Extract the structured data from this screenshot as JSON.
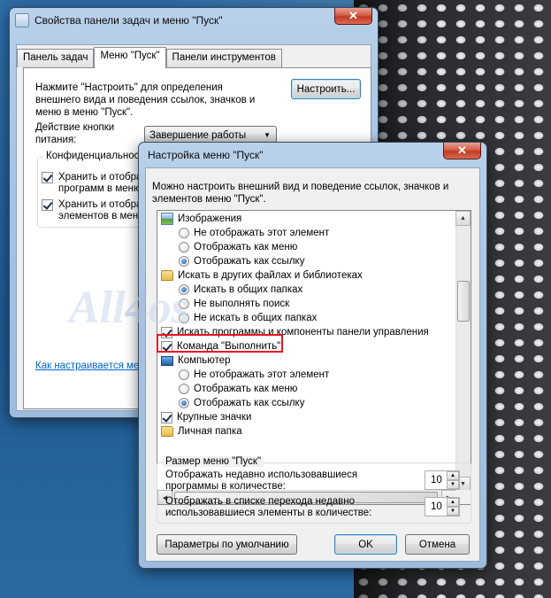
{
  "back_window": {
    "title": "Свойства панели задач и меню \"Пуск\"",
    "close_glyph": "✕",
    "tabs": [
      {
        "label": "Панель задач",
        "active": false
      },
      {
        "label": "Меню \"Пуск\"",
        "active": true
      },
      {
        "label": "Панели инструментов",
        "active": false
      }
    ],
    "customize_text": "Нажмите \"Настроить\" для определения внешнего вида и поведения ссылок, значков и меню в меню \"Пуск\".",
    "customize_button": "Настроить...",
    "power_action_label": "Действие кнопки питания:",
    "power_action_value": "Завершение работы",
    "privacy_group_title": "Конфиденциальность",
    "privacy_items": [
      {
        "label": "Хранить и отобра",
        "label2": "программ в меню",
        "checked": true
      },
      {
        "label": "Хранить и отобра",
        "label2": "элементов в меню",
        "checked": true
      }
    ],
    "help_link": "Как настраивается меню"
  },
  "watermark": {
    "part1": "All",
    "part2": "4",
    "part3": "os"
  },
  "dialog": {
    "title": "Настройка меню \"Пуск\"",
    "close_glyph": "✕",
    "description": "Можно настроить внешний вид и поведение ссылок, значков и элементов меню \"Пуск\".",
    "items": [
      {
        "kind": "icon",
        "icon": "image-icon",
        "label": "Изображения"
      },
      {
        "kind": "radio",
        "selected": false,
        "label": "Не отображать этот элемент"
      },
      {
        "kind": "radio",
        "selected": false,
        "label": "Отображать как меню"
      },
      {
        "kind": "radio",
        "selected": true,
        "label": "Отображать как ссылку"
      },
      {
        "kind": "icon",
        "icon": "folder-icon",
        "label": "Искать в других файлах и библиотеках"
      },
      {
        "kind": "radio",
        "selected": true,
        "label": "Искать в общих папках"
      },
      {
        "kind": "radio",
        "selected": false,
        "label": "Не выполнять поиск"
      },
      {
        "kind": "radio",
        "selected": false,
        "label": "Не искать в общих папках"
      },
      {
        "kind": "check",
        "checked": true,
        "label": "Искать программы и компоненты панели управления"
      },
      {
        "kind": "check",
        "checked": true,
        "label": "Команда \"Выполнить\""
      },
      {
        "kind": "icon",
        "icon": "computer-icon",
        "label": "Компьютер"
      },
      {
        "kind": "radio",
        "selected": false,
        "label": "Не отображать этот элемент"
      },
      {
        "kind": "radio",
        "selected": false,
        "label": "Отображать как меню"
      },
      {
        "kind": "radio",
        "selected": true,
        "label": "Отображать как ссылку"
      },
      {
        "kind": "check",
        "checked": true,
        "label": "Крупные значки"
      },
      {
        "kind": "icon",
        "icon": "folder-icon",
        "label": "Личная папка"
      }
    ],
    "size_group_title": "Размер меню \"Пуск\"",
    "recent_programs_label": "Отображать недавно использовавшиеся программы в количестве:",
    "recent_programs_value": "10",
    "jumplist_label": "Отображать в списке перехода недавно использовавшиеся элементы в количестве:",
    "jumplist_value": "10",
    "defaults_button": "Параметры по умолчанию",
    "ok_button": "OK",
    "cancel_button": "Отмена"
  },
  "colors": {
    "highlight": "#e8141e",
    "link": "#0066cc",
    "close_button": "#c23a24"
  }
}
